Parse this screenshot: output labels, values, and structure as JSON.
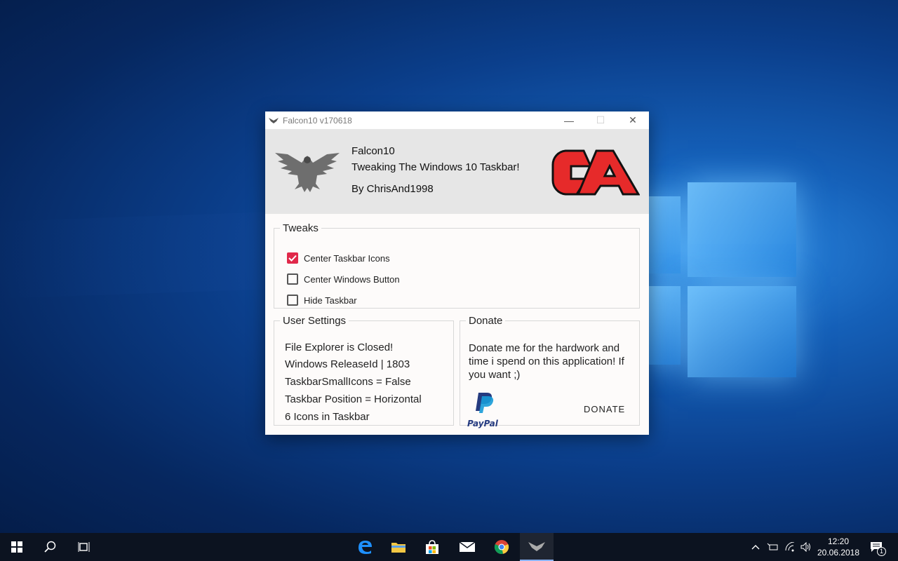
{
  "window": {
    "title": "Falcon10 v170618",
    "minimize_glyph": "—",
    "maximize_glyph": "☐",
    "close_glyph": "✕"
  },
  "header": {
    "app_name": "Falcon10",
    "tagline": "Tweaking The Windows 10 Taskbar!",
    "author": "By ChrisAnd1998"
  },
  "tweaks": {
    "legend": "Tweaks",
    "options": [
      {
        "label": "Center Taskbar Icons",
        "checked": true
      },
      {
        "label": "Center Windows Button",
        "checked": false
      },
      {
        "label": "Hide Taskbar",
        "checked": false
      }
    ]
  },
  "user_settings": {
    "legend": "User Settings",
    "lines": [
      "File Explorer is Closed!",
      "Windows ReleaseId | 1803",
      "TaskbarSmallIcons = False",
      "Taskbar Position = Horizontal",
      "6 Icons in Taskbar"
    ]
  },
  "donate": {
    "legend": "Donate",
    "message": "Donate me for the hardwork and time i spend on this application! If you want ;)",
    "paypal_label": "PayPal",
    "button_label": "DONATE"
  },
  "taskbar": {
    "pinned": [
      "edge-icon",
      "file-explorer-icon",
      "store-icon",
      "mail-icon",
      "chrome-icon",
      "falcon10-icon"
    ],
    "clock_time": "12:20",
    "clock_date": "20.06.2018",
    "notification_count": "1"
  },
  "colors": {
    "accent_red": "#e0284a",
    "header_bg": "#e6e6e6",
    "taskbar_bg": "#0c1320"
  }
}
